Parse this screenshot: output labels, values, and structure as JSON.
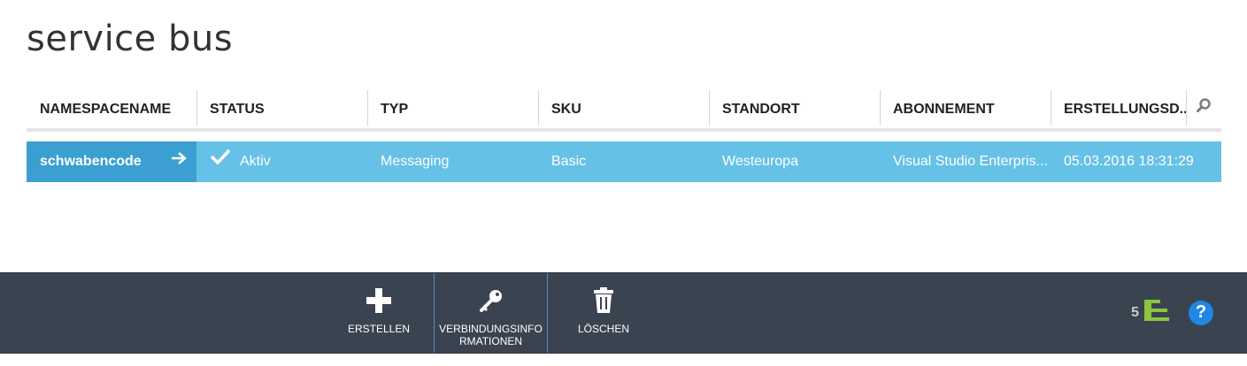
{
  "page": {
    "title": "service bus"
  },
  "table": {
    "columns": [
      "NAMESPACENAME",
      "STATUS",
      "TYP",
      "SKU",
      "STANDORT",
      "ABONNEMENT",
      "ERSTELLUNGSD..."
    ],
    "rows": [
      {
        "name": "schwabencode",
        "status": "Aktiv",
        "type": "Messaging",
        "sku": "Basic",
        "location": "Westeuropa",
        "subscription": "Visual Studio Enterpris...",
        "created": "05.03.2016 18:31:29"
      }
    ]
  },
  "toolbar": {
    "create_label": "ERSTELLEN",
    "connection_label": "VERBINDUNGSINFORMATIONEN",
    "delete_label": "LÖSCHEN",
    "notifications_count": "5",
    "help_label": "?"
  },
  "colors": {
    "row_selected": "#66c1e6",
    "row_name_cell": "#3ba0d1",
    "toolbar_bg": "#3a4350",
    "notification_accent": "#8cc63f",
    "help_accent": "#1e88e5"
  },
  "icons": {
    "search": "search-icon",
    "arrow": "arrow-right-icon",
    "status": "checkmark-icon",
    "create": "plus-icon",
    "connection": "key-icon",
    "delete": "trash-icon",
    "notifications": "notifications-icon",
    "help": "help-icon"
  }
}
